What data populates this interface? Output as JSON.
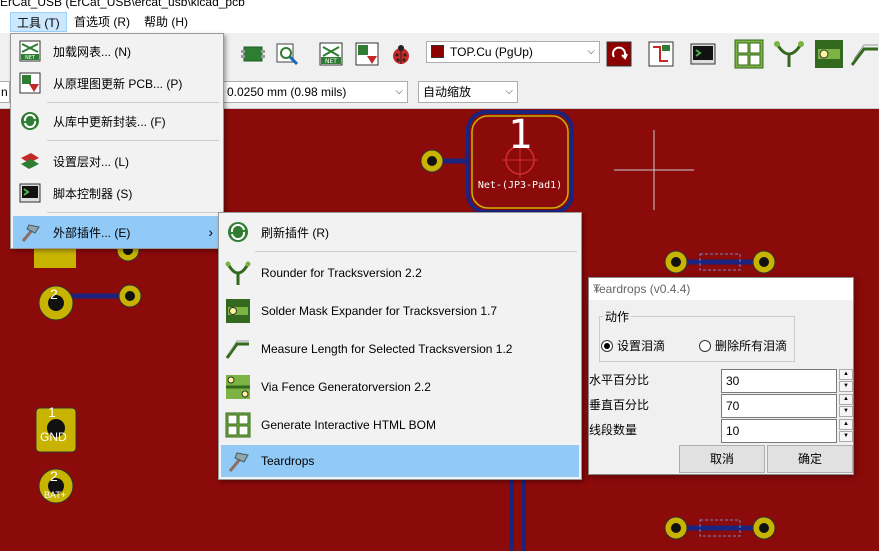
{
  "window": {
    "title": "ErCat_USB (ErCat_USB\\ercat_usb\\kicad_pcb"
  },
  "menubar": [
    {
      "label": "工具 (T)",
      "active": true
    },
    {
      "label": "首选项 (R)"
    },
    {
      "label": "帮助 (H)"
    }
  ],
  "toolbar": {
    "layer_select": "TOP.Cu (PgUp)",
    "grid_select": "0.0250 mm (0.98 mils)",
    "grid_prefix": "n (",
    "zoom_select": "自动缩放"
  },
  "tools_menu": {
    "items": [
      {
        "label": "加载网表... (N)",
        "icon": "netlist-icon"
      },
      {
        "label": "从原理图更新 PCB... (P)",
        "icon": "update-pcb-icon"
      },
      {
        "label": "从库中更新封装... (F)",
        "icon": "refresh-footprint-icon"
      },
      {
        "label": "设置层对... (L)",
        "icon": "layer-pair-icon"
      },
      {
        "label": "脚本控制器 (S)",
        "icon": "scripting-console-icon"
      },
      {
        "label": "外部插件... (E)",
        "icon": "plugin-hammer-icon",
        "submenu_arrow": "›"
      }
    ]
  },
  "plugins_menu": {
    "items": [
      {
        "label": "刷新插件 (R)",
        "icon": "refresh-plugins-icon"
      },
      {
        "label": "Rounder for Tracksversion 2.2",
        "icon": "rounder-icon"
      },
      {
        "label": "Solder Mask Expander for Tracksversion 1.7",
        "icon": "solder-mask-icon"
      },
      {
        "label": "Measure Length for Selected Tracksversion 1.2",
        "icon": "measure-length-icon"
      },
      {
        "label": "Via Fence Generatorversion 2.2",
        "icon": "via-fence-icon"
      },
      {
        "label": "Generate Interactive HTML BOM",
        "icon": "html-bom-icon"
      },
      {
        "label": "Teardrops",
        "icon": "teardrops-hammer-icon"
      }
    ]
  },
  "pcb": {
    "pad_number": "1",
    "pad_net": "Net-(JP3-Pad1)",
    "gnd_number": "1",
    "gnd_label": "GND",
    "bat_number": "2",
    "bat_label": "BAT+",
    "pad2_number": "2"
  },
  "dialog": {
    "title": "Teardrops (v0.4.4)",
    "close": "×",
    "group_label": "动作",
    "radio_set": "设置泪滴",
    "radio_delete": "删除所有泪滴",
    "fields": [
      {
        "label": "水平百分比",
        "value": "30"
      },
      {
        "label": "垂直百分比",
        "value": "70"
      },
      {
        "label": "线段数量",
        "value": "10"
      }
    ],
    "cancel": "取消",
    "ok": "确定"
  },
  "colors": {
    "board": "#8b0a0a",
    "pad": "#c8b400",
    "track": "#1a237e",
    "menu_highlight": "#91c9f7"
  }
}
